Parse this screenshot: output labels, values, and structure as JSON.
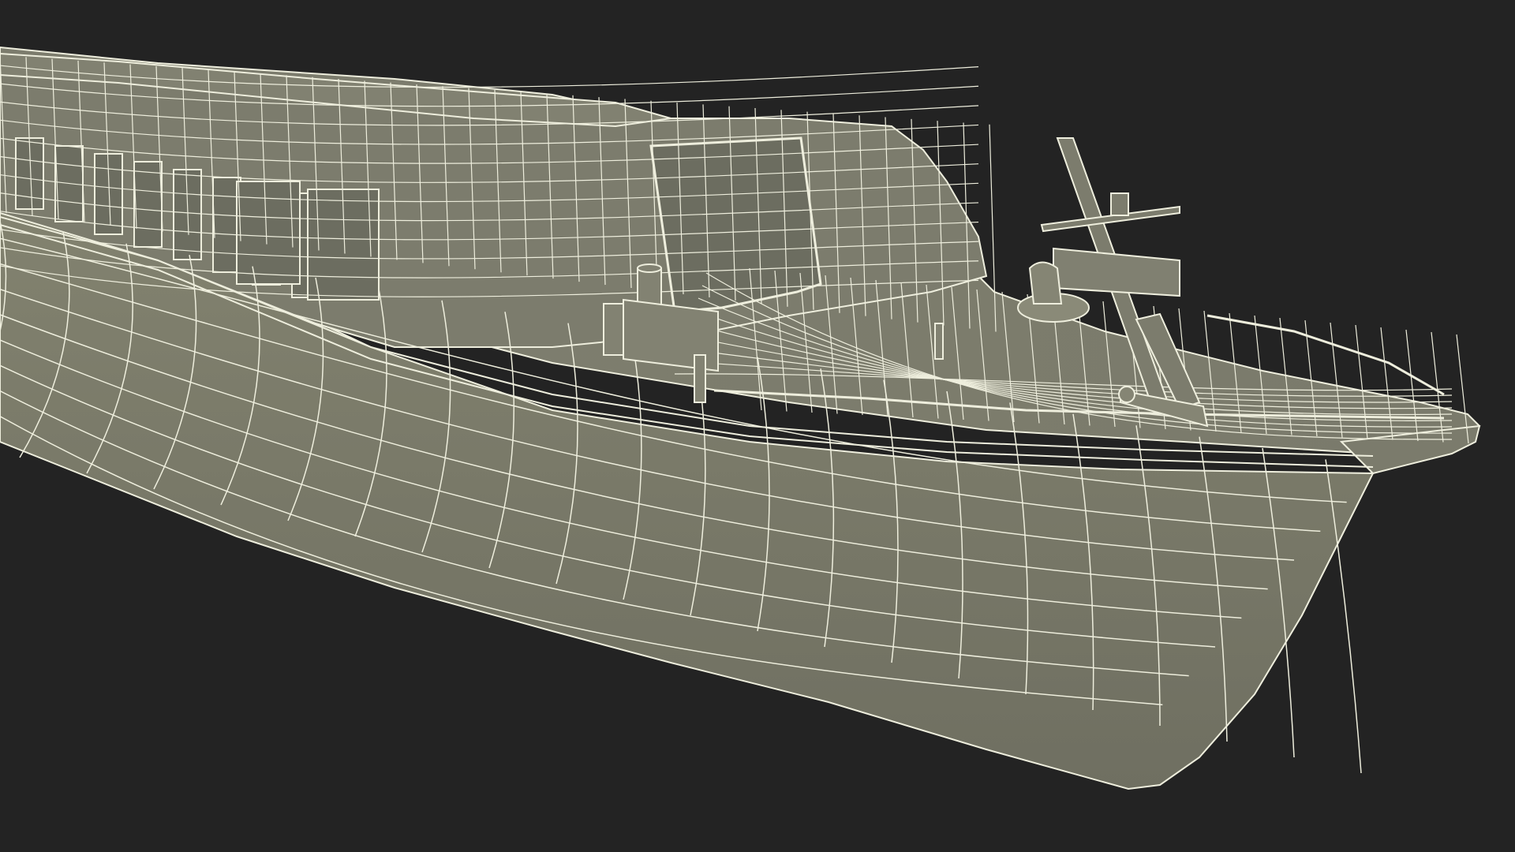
{
  "scene": {
    "subject": "boat-hull-wireframe-render",
    "background_color": "#232323",
    "surface_color": "#7a7a6c",
    "surface_shadow_color": "#6b6b5e",
    "wire_color": "#eeeedd",
    "glass_color": "#6c6d60"
  }
}
